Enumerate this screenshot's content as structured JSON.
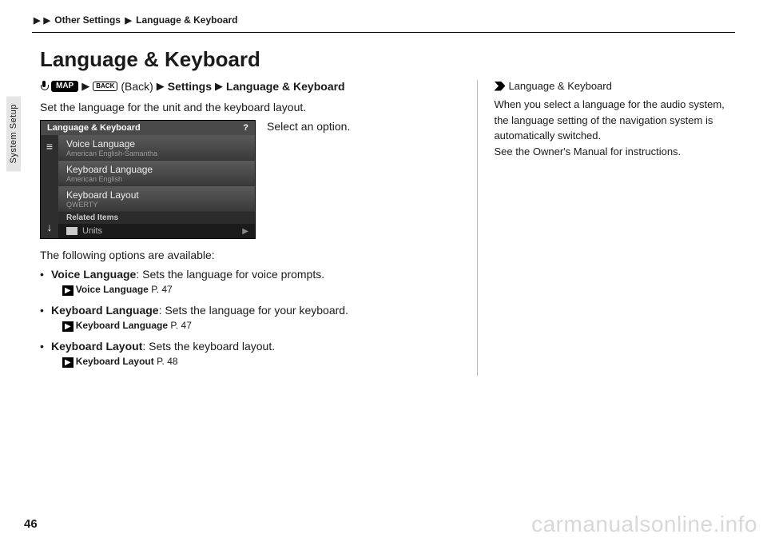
{
  "breadcrumb": {
    "arrow": "▶",
    "level1": "Other Settings",
    "level2": "Language & Keyboard"
  },
  "sidetab": "System Setup",
  "title": "Language & Keyboard",
  "navpath": {
    "map": "MAP",
    "back_icon": "BACK",
    "back_text": "(Back)",
    "settings": "Settings",
    "final": "Language & Keyboard"
  },
  "lead": "Set the language for the unit and the keyboard layout.",
  "instruction": "Select an option.",
  "sim": {
    "title": "Language & Keyboard",
    "help": "?",
    "menu": "≡",
    "down": "↓",
    "items": [
      {
        "main": "Voice Language",
        "sub": "American English-Samantha"
      },
      {
        "main": "Keyboard Language",
        "sub": "American English"
      },
      {
        "main": "Keyboard Layout",
        "sub": "QWERTY"
      }
    ],
    "related": "Related Items",
    "foot": "Units"
  },
  "avail": "The following options are available:",
  "options": [
    {
      "label": "Voice Language",
      "desc": ": Sets the language for voice prompts.",
      "ref_label": "Voice Language",
      "ref_page": "P. 47"
    },
    {
      "label": "Keyboard Language",
      "desc": ": Sets the language for your keyboard.",
      "ref_label": "Keyboard Language",
      "ref_page": "P. 47"
    },
    {
      "label": "Keyboard Layout",
      "desc": ": Sets the keyboard layout.",
      "ref_label": "Keyboard Layout",
      "ref_page": "P. 48"
    }
  ],
  "note": {
    "head": "Language & Keyboard",
    "body1": "When you select a language for the audio system, the language setting of the navigation system is automatically switched.",
    "body2": "See the Owner's Manual for instructions."
  },
  "pagenum": "46",
  "watermark": "carmanualsonline.info"
}
